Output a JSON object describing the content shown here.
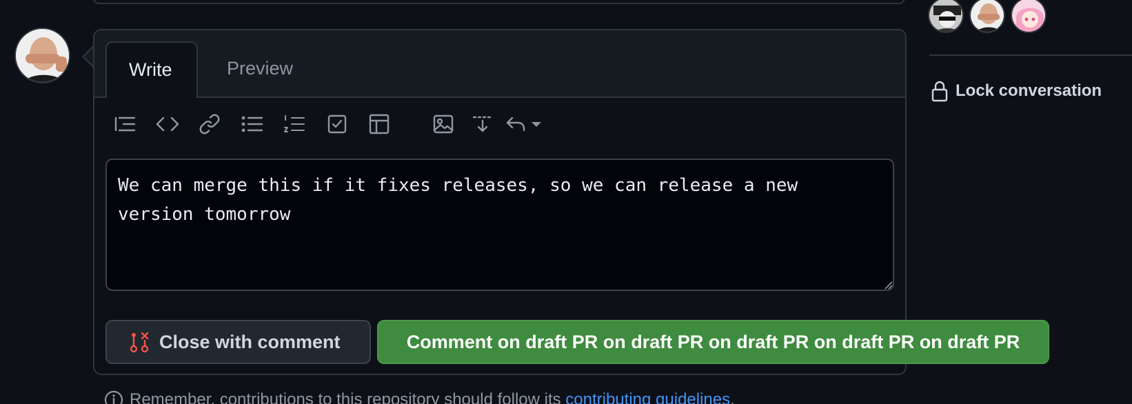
{
  "editor": {
    "tabs": [
      {
        "label": "Write",
        "active": true
      },
      {
        "label": "Preview",
        "active": false
      }
    ],
    "toolbar_icons": [
      "heading-icon",
      "code-icon",
      "link-icon",
      "bullet-list-icon",
      "numbered-list-icon",
      "task-list-icon",
      "table-icon",
      "image-icon",
      "insert-icon",
      "undo-icon"
    ],
    "textarea_value": "We can merge this if it fixes releases, so we can release a new version tomorrow"
  },
  "actions": {
    "close_label": "Close with comment",
    "comment_label": "Comment on draft PR on draft PR on draft PR on draft PR on draft PR",
    "comment_color": "#3f8b3f",
    "close_icon_color": "#f85149"
  },
  "footer": {
    "text_before": "Remember, contributions to this repository should follow its ",
    "link_text": "contributing guidelines",
    "text_after": "."
  },
  "sidebar": {
    "lock_label": "Lock conversation"
  }
}
